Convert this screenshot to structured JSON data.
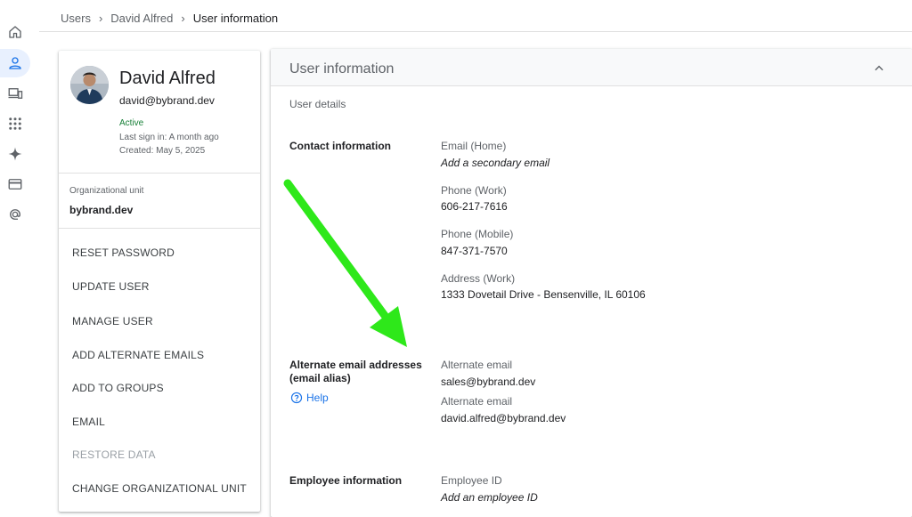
{
  "rail": {
    "items": [
      {
        "icon": "home-icon"
      },
      {
        "icon": "user-icon",
        "active": true
      },
      {
        "icon": "devices-icon"
      },
      {
        "icon": "apps-icon"
      },
      {
        "icon": "sparkle-icon"
      },
      {
        "icon": "billing-card-icon"
      },
      {
        "icon": "at-sign-icon"
      }
    ]
  },
  "breadcrumb": {
    "items": [
      "Users",
      "David Alfred"
    ],
    "current": "User information",
    "separator": "›"
  },
  "profile": {
    "name": "David Alfred",
    "email": "david@bybrand.dev",
    "status": "Active",
    "last_sign_in": "Last sign in: A month ago",
    "created": "Created: May 5, 2025",
    "org_unit_label": "Organizational unit",
    "org_unit_value": "bybrand.dev"
  },
  "actions": [
    {
      "label": "RESET PASSWORD",
      "disabled": false
    },
    {
      "label": "UPDATE USER",
      "disabled": false
    },
    {
      "label": "MANAGE USER",
      "disabled": false
    },
    {
      "label": "ADD ALTERNATE EMAILS",
      "disabled": false
    },
    {
      "label": "ADD TO GROUPS",
      "disabled": false
    },
    {
      "label": "EMAIL",
      "disabled": false
    },
    {
      "label": "RESTORE DATA",
      "disabled": true
    },
    {
      "label": "CHANGE ORGANIZATIONAL UNIT",
      "disabled": false
    }
  ],
  "main": {
    "title": "User information",
    "subtitle": "User details",
    "contact": {
      "title": "Contact information",
      "fields": [
        {
          "label": "Email (Home)",
          "value": "Add a secondary email",
          "placeholder": true
        },
        {
          "label": "Phone (Work)",
          "value": "606-217-7616",
          "placeholder": false
        },
        {
          "label": "Phone (Mobile)",
          "value": "847-371-7570",
          "placeholder": false
        },
        {
          "label": "Address (Work)",
          "value": "1333 Dovetail Drive - Bensenville, IL 60106",
          "placeholder": false
        }
      ]
    },
    "alias": {
      "title_line1": "Alternate email addresses",
      "title_line2": "(email alias)",
      "help": "Help",
      "fields": [
        {
          "label": "Alternate email",
          "value": "sales@bybrand.dev"
        },
        {
          "label": "Alternate email",
          "value": "david.alfred@bybrand.dev"
        }
      ]
    },
    "employee": {
      "title": "Employee information",
      "fields": [
        {
          "label": "Employee ID",
          "value": "Add an employee ID",
          "placeholder": true
        }
      ]
    }
  },
  "colors": {
    "accent": "#1a73e8",
    "active_green": "#188038",
    "annotation_arrow": "#2ee81a"
  }
}
